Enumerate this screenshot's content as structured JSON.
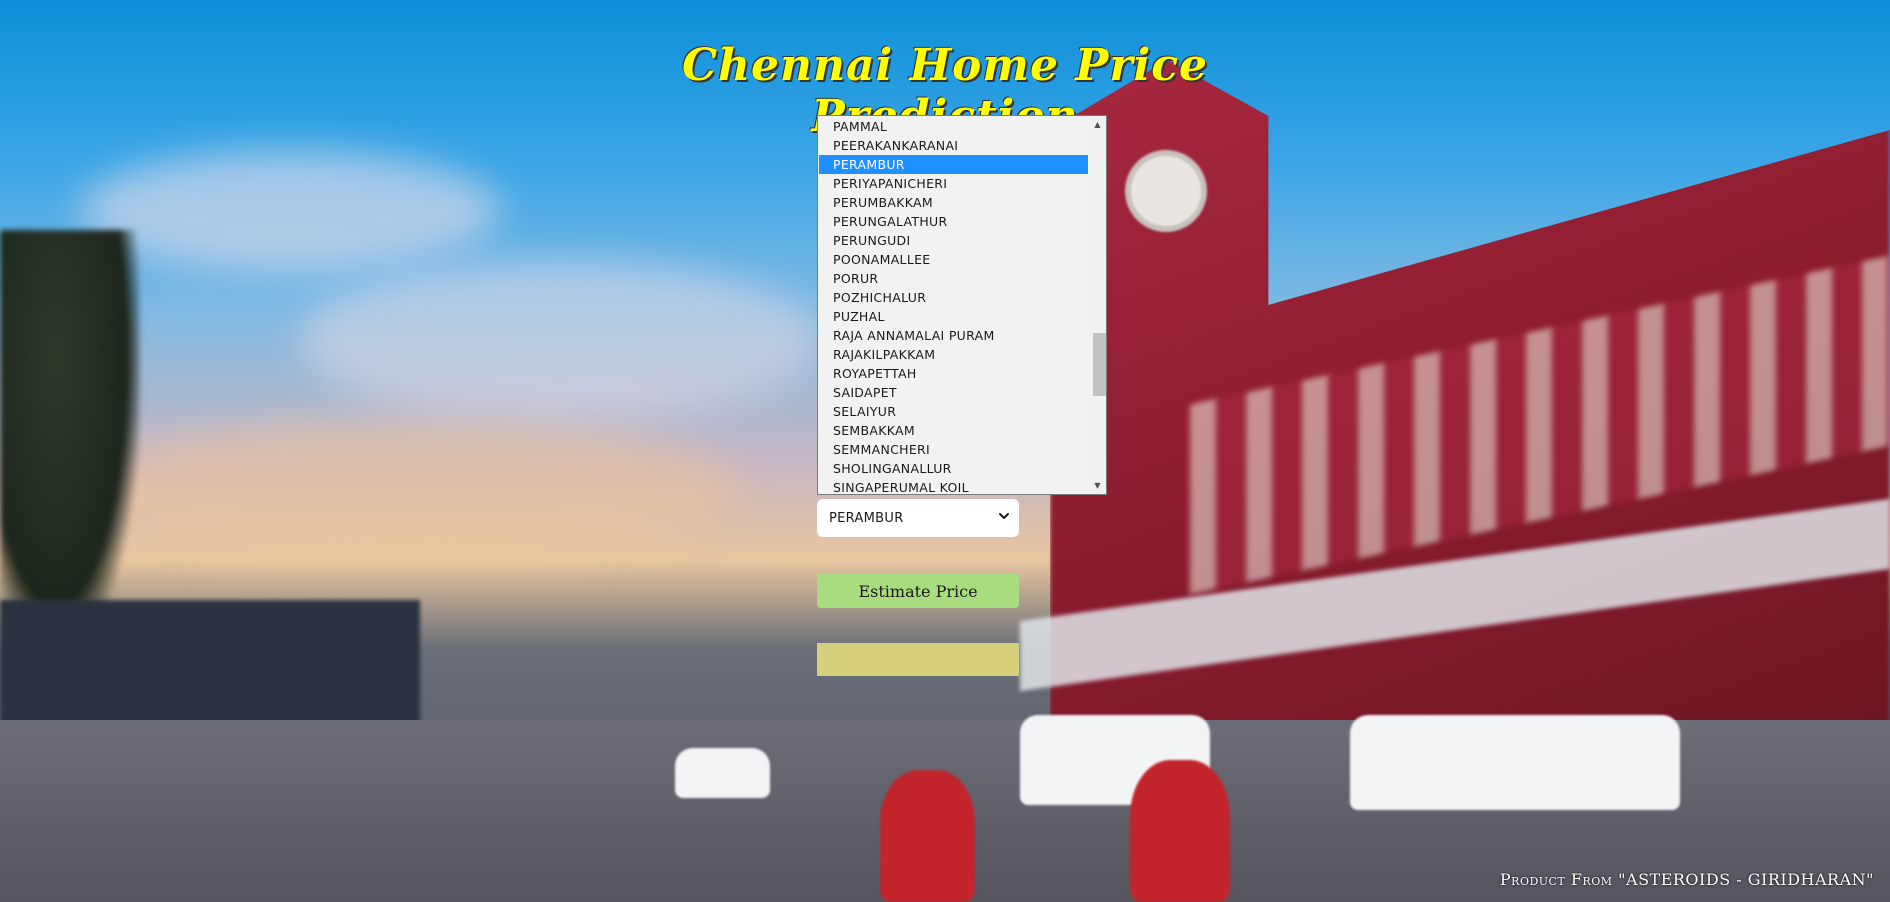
{
  "title": "Chennai Home Price Prediction",
  "location_list": {
    "items": [
      "PAMMAL",
      "PEERAKANKARANAI",
      "PERAMBUR",
      "PERIYAPANICHERI",
      "PERUMBAKKAM",
      "PERUNGALATHUR",
      "PERUNGUDI",
      "POONAMALLEE",
      "PORUR",
      "POZHICHALUR",
      "PUZHAL",
      "RAJA ANNAMALAI PURAM",
      "RAJAKILPAKKAM",
      "ROYAPETTAH",
      "SAIDAPET",
      "SELAIYUR",
      "SEMBAKKAM",
      "SEMMANCHERI",
      "SHOLINGANALLUR",
      "SINGAPERUMAL KOIL"
    ],
    "selected_index": 2,
    "scroll_up_icon": "triangle-up-icon",
    "scroll_down_icon": "triangle-down-icon"
  },
  "location_select": {
    "value": "PERAMBUR",
    "chevron_icon": "chevron-down-icon"
  },
  "estimate_button": {
    "label": "Estimate Price",
    "color": "#a9dc7f"
  },
  "result": {
    "value": "",
    "color": "#d6cf7c"
  },
  "footer": "Product From \"ASTEROIDS - GIRIDHARAN\"",
  "colors": {
    "title": "#ffff00",
    "selection": "#1e90ff"
  }
}
